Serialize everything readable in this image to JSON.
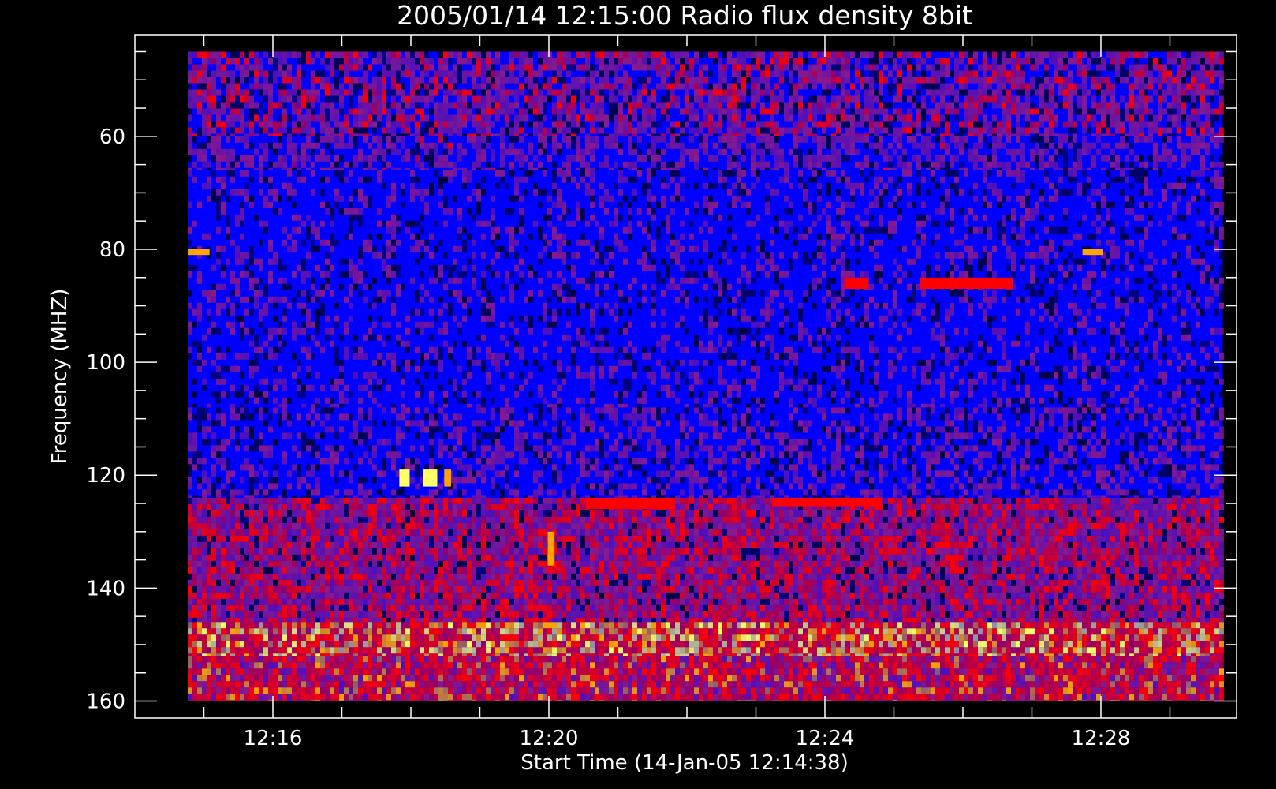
{
  "chart_data": {
    "type": "heatmap",
    "title": "2005/01/14 12:15:00 Radio flux density 8bit",
    "xlabel": "Start Time (14-Jan-05 12:14:38)",
    "ylabel": "Frequency (MHZ)",
    "x_range_minutes": [
      -0.633,
      15.333
    ],
    "y_range_mhz": [
      42,
      163
    ],
    "data_x_range_minutes": [
      0.133,
      15.133
    ],
    "data_y_range_mhz": [
      45,
      160
    ],
    "y_axis_reversed": true,
    "x_ticks": [
      {
        "label": "12:16",
        "minutes": 1.367
      },
      {
        "label": "12:20",
        "minutes": 5.367
      },
      {
        "label": "12:24",
        "minutes": 9.367
      },
      {
        "label": "12:28",
        "minutes": 13.367
      }
    ],
    "y_ticks": [
      {
        "label": "60",
        "value": 60
      },
      {
        "label": "80",
        "value": 80
      },
      {
        "label": "100",
        "value": 100
      },
      {
        "label": "120",
        "value": 120
      },
      {
        "label": "140",
        "value": 140
      },
      {
        "label": "160",
        "value": 160
      }
    ],
    "colormap": {
      "background": "#0000ff",
      "dark": "#00003c",
      "mid": "#8a1a8a",
      "hot": "#ff0000",
      "hotter": "#ffa500",
      "hottest": "#ffff66"
    },
    "frequency_bands": [
      {
        "from_mhz": 45,
        "to_mhz": 60,
        "level": 0.28
      },
      {
        "from_mhz": 60,
        "to_mhz": 66,
        "level": 0.18
      },
      {
        "from_mhz": 66,
        "to_mhz": 108,
        "level": 0.05
      },
      {
        "from_mhz": 108,
        "to_mhz": 124,
        "level": 0.12
      },
      {
        "from_mhz": 124,
        "to_mhz": 146,
        "level": 0.42
      },
      {
        "from_mhz": 146,
        "to_mhz": 152,
        "level": 0.78
      },
      {
        "from_mhz": 152,
        "to_mhz": 160,
        "level": 0.6
      }
    ],
    "bright_features": [
      {
        "minutes": 0.133,
        "to_minutes": 0.45,
        "mhz": 80,
        "to_mhz": 81,
        "level": 0.8
      },
      {
        "minutes": 13.1,
        "to_minutes": 13.4,
        "mhz": 80,
        "to_mhz": 81,
        "level": 0.8
      },
      {
        "minutes": 3.2,
        "to_minutes": 3.35,
        "mhz": 119,
        "to_mhz": 122,
        "level": 0.95
      },
      {
        "minutes": 3.55,
        "to_minutes": 3.75,
        "mhz": 119,
        "to_mhz": 122,
        "level": 0.95
      },
      {
        "minutes": 3.85,
        "to_minutes": 3.95,
        "mhz": 119,
        "to_mhz": 122,
        "level": 0.9
      },
      {
        "minutes": 5.9,
        "to_minutes": 7.2,
        "mhz": 124,
        "to_mhz": 126,
        "level": 0.75
      },
      {
        "minutes": 8.6,
        "to_minutes": 10.2,
        "mhz": 124,
        "to_mhz": 125.5,
        "level": 0.75
      },
      {
        "minutes": 9.65,
        "to_minutes": 10.0,
        "mhz": 85,
        "to_mhz": 87,
        "level": 0.55
      },
      {
        "minutes": 10.75,
        "to_minutes": 12.1,
        "mhz": 85,
        "to_mhz": 87,
        "level": 0.55
      },
      {
        "minutes": 5.35,
        "to_minutes": 5.45,
        "mhz": 130,
        "to_mhz": 136,
        "level": 0.9
      }
    ]
  }
}
